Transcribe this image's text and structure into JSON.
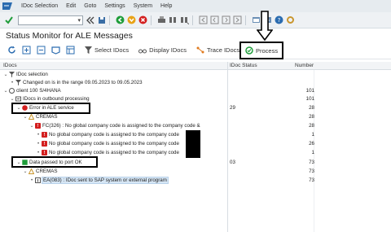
{
  "menubar": {
    "items": [
      "IDoc Selection",
      "Edit",
      "Goto",
      "Settings",
      "System",
      "Help"
    ]
  },
  "title": "Status Monitor for ALE Messages",
  "app_toolbar": {
    "select_idocs": "Select IDocs",
    "display_idocs": "Display IDocs",
    "trace_idocs": "Trace IDocs",
    "process": "Process"
  },
  "table": {
    "headers": [
      "IDocs",
      "IDoc Status",
      "Number"
    ],
    "rows": [
      {
        "text": "IDoc selection",
        "status": "",
        "number": ""
      },
      {
        "text": "Changed on is in the range 09.05.2023 to 09.05.2023",
        "status": "",
        "number": ""
      },
      {
        "text": "client 100 S/4HANA",
        "status": "",
        "number": "101"
      },
      {
        "text": "IDocs in outbound processing",
        "status": "",
        "number": "101"
      },
      {
        "text": "Error in ALE service",
        "status": "29",
        "number": "28"
      },
      {
        "text": "CREMAS",
        "status": "",
        "number": "28"
      },
      {
        "text": "FC(326) : No global company code is assigned to the company code &",
        "status": "",
        "number": "28"
      },
      {
        "text": "No global company code is assigned to the company code",
        "status": "",
        "number": "1"
      },
      {
        "text": "No global company code is assigned to the company code",
        "status": "",
        "number": "26"
      },
      {
        "text": "No global company code is assigned to the company code",
        "status": "",
        "number": "1"
      },
      {
        "text": "Data passed to port OK",
        "status": "03",
        "number": "73"
      },
      {
        "text": "CREMAS",
        "status": "",
        "number": "73"
      },
      {
        "text": "EA(083) : IDoc sent to SAP system or external program",
        "status": "",
        "number": "73"
      }
    ]
  },
  "colors": {
    "error_red": "#d31f1f",
    "ok_green": "#1f9d3a",
    "selection_blue": "#d6e6f5"
  }
}
